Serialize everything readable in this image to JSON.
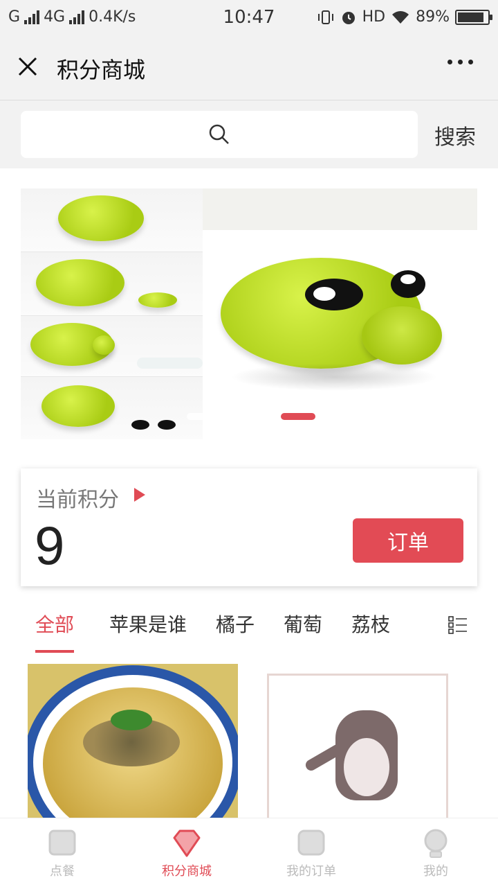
{
  "status_bar": {
    "network": "G",
    "network_type": "4G",
    "speed": "0.4K/s",
    "time": "10:47",
    "hd": "HD",
    "battery": "89%",
    "battery_level": 0.89,
    "icons": [
      "signal-icon",
      "vibrate-icon",
      "alarm-icon",
      "wifi-icon",
      "battery-icon"
    ]
  },
  "header": {
    "title": "积分商城",
    "close_icon": "close-icon",
    "more_icon": "more-icon"
  },
  "search": {
    "placeholder": "",
    "button_label": "搜索"
  },
  "banner": {
    "slide_count": 3,
    "active_slide": 3
  },
  "points": {
    "label": "当前积分",
    "value": "9",
    "order_button": "订单"
  },
  "categories": {
    "items": [
      {
        "label": "全部",
        "active": true
      },
      {
        "label": "苹果是谁",
        "active": false
      },
      {
        "label": "橘子",
        "active": false
      },
      {
        "label": "葡萄",
        "active": false
      },
      {
        "label": "荔枝",
        "active": false
      }
    ]
  },
  "tabbar": {
    "items": [
      {
        "label": "点餐",
        "icon": "order-food-icon",
        "active": false
      },
      {
        "label": "积分商城",
        "icon": "diamond-icon",
        "active": true
      },
      {
        "label": "我的订单",
        "icon": "orders-icon",
        "active": false
      },
      {
        "label": "我的",
        "icon": "user-icon",
        "active": false
      }
    ]
  },
  "colors": {
    "accent": "#e04b55",
    "background": "#f2f2f2"
  }
}
